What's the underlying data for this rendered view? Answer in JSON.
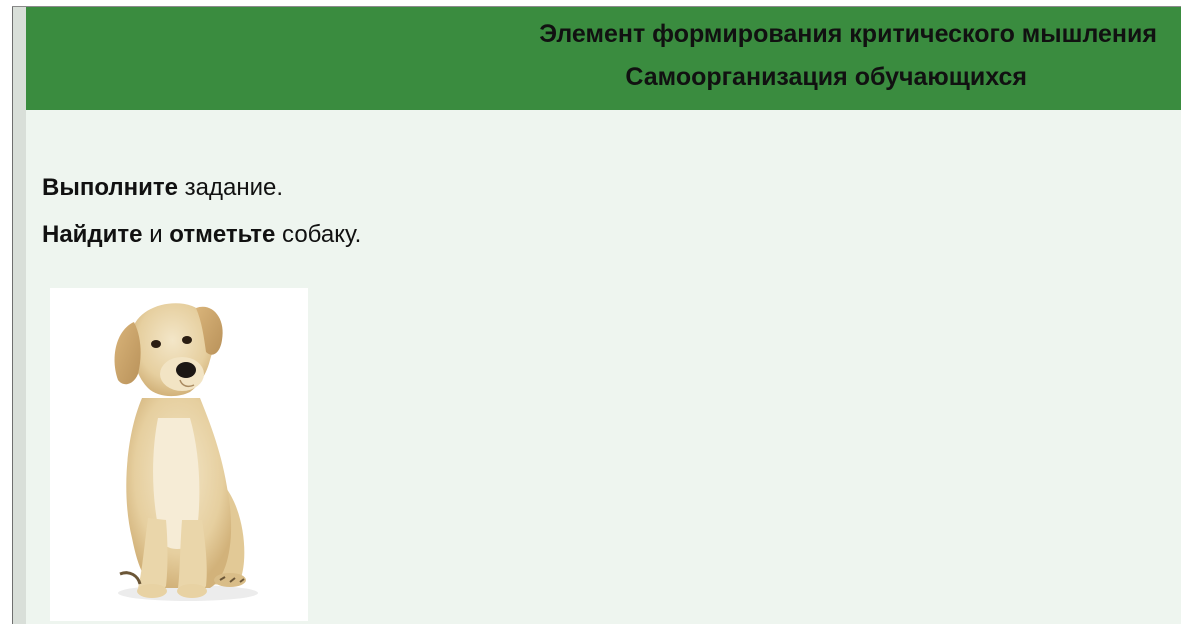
{
  "header": {
    "line1": "Элемент формирования критического мышления",
    "line2": "Самоорганизация обучающихся"
  },
  "task": {
    "line1": {
      "bold": "Выполните",
      "rest": " задание."
    },
    "line2": {
      "bold1": "Найдите",
      "mid": " и ",
      "bold2": "отметьте",
      "rest": " собаку."
    }
  },
  "image": {
    "subject": "dog",
    "icon": "dog-photo"
  },
  "colors": {
    "header_bg": "#3a8c3f",
    "card_bg": "#eef5ef",
    "text": "#111111"
  }
}
